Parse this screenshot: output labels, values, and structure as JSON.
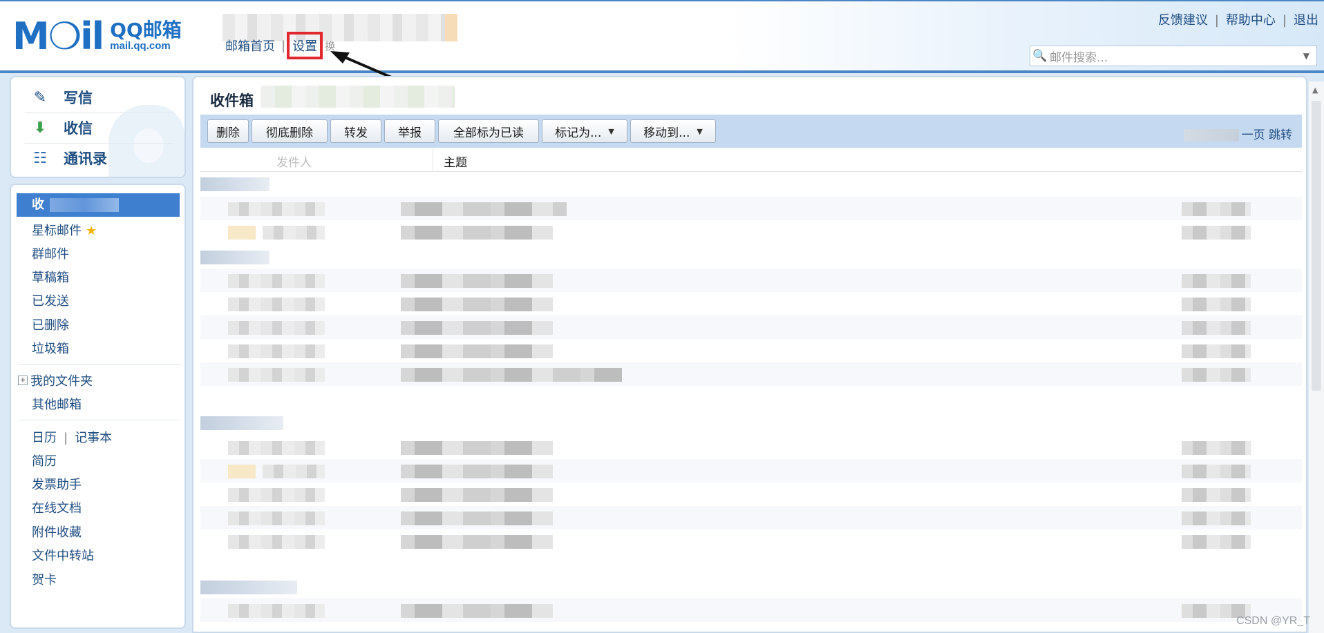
{
  "header": {
    "logo_mark": "M❍il",
    "logo_title": "QQ邮箱",
    "logo_url": "mail.qq.com",
    "nav": [
      "邮箱首页",
      "设置",
      "换"
    ],
    "links": [
      "反馈建议",
      "帮助中心",
      "退出"
    ],
    "search_placeholder": "邮件搜索...",
    "highlight_color": "#e0282e"
  },
  "compose": {
    "items": [
      {
        "label": "写信",
        "icon": "pencil-icon"
      },
      {
        "label": "收信",
        "icon": "download-icon"
      },
      {
        "label": "通讯录",
        "icon": "contact-card-icon"
      }
    ]
  },
  "folders": {
    "active": "收",
    "items": [
      "星标邮件",
      "群邮件",
      "草稿箱",
      "已发送",
      "已删除",
      "垃圾箱"
    ],
    "my_folders": "我的文件夹",
    "other": "其他邮箱",
    "tools": [
      "日历",
      "记事本",
      "简历",
      "发票助手",
      "在线文档",
      "附件收藏",
      "文件中转站",
      "贺卡"
    ]
  },
  "main": {
    "title": "收件箱",
    "toolbar": [
      "删除",
      "彻底删除",
      "转发",
      "举报",
      "全部标为已读",
      "标记为...",
      "移动到..."
    ],
    "pager": "一页 跳转",
    "columns": {
      "sender": "发件人",
      "subject": "主题"
    }
  },
  "watermark": "CSDN @YR_T",
  "colors": {
    "brand": "#1f6fc2",
    "active_folder": "#3f7fd0",
    "toolbar": "#c5d9f1"
  }
}
